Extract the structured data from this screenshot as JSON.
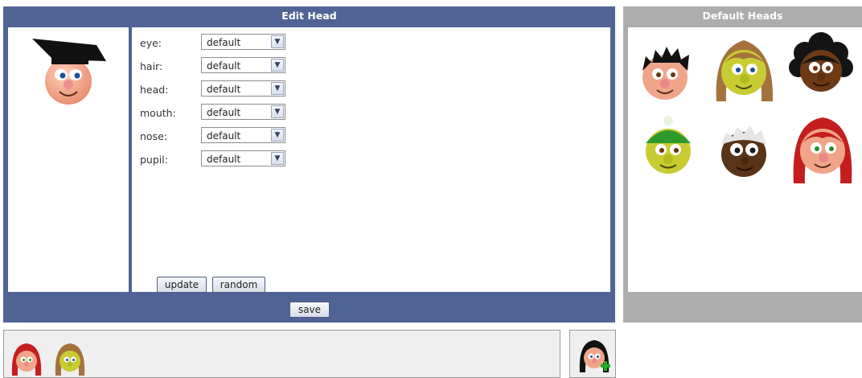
{
  "edit_panel": {
    "title": "Edit Head",
    "options": [
      {
        "label": "eye:",
        "value": "default"
      },
      {
        "label": "hair:",
        "value": "default"
      },
      {
        "label": "head:",
        "value": "default"
      },
      {
        "label": "mouth:",
        "value": "default"
      },
      {
        "label": "nose:",
        "value": "default"
      },
      {
        "label": "pupil:",
        "value": "default"
      }
    ],
    "update_label": "update",
    "random_label": "random",
    "save_label": "save"
  },
  "default_panel": {
    "title": "Default Heads"
  },
  "colors": {
    "edit_panel_bg": "#4f6494",
    "default_panel_bg": "#adadad",
    "bottom_bar_bg": "#efefef"
  }
}
